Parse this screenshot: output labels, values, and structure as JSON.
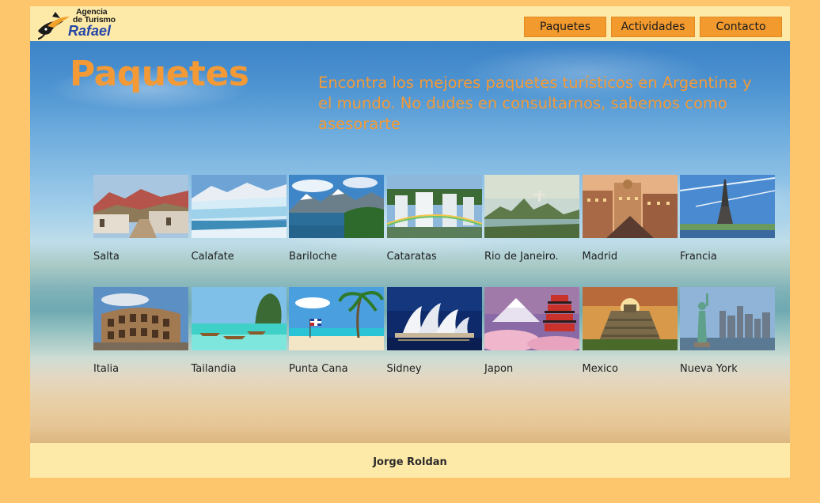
{
  "logo": {
    "line1": "Agencia",
    "line2": "de Turismo",
    "line3": "Rafael"
  },
  "nav": {
    "items": [
      {
        "label": "Paquetes"
      },
      {
        "label": "Actividades"
      },
      {
        "label": "Contacto"
      }
    ]
  },
  "hero": {
    "title": "Paquetes",
    "description": "Encontra los mejores paquetes turísticos en Argentina y el mundo. No dudes en consultarnos, sabemos como asesorarte"
  },
  "packages": {
    "row1": [
      {
        "name": "Salta"
      },
      {
        "name": "Calafate"
      },
      {
        "name": "Bariloche"
      },
      {
        "name": "Cataratas"
      },
      {
        "name": "Rio de Janeiro."
      },
      {
        "name": "Madrid"
      },
      {
        "name": "Francia"
      }
    ],
    "row2": [
      {
        "name": "Italia"
      },
      {
        "name": "Tailandia"
      },
      {
        "name": "Punta Cana"
      },
      {
        "name": "Sidney"
      },
      {
        "name": "Japon"
      },
      {
        "name": "Mexico"
      },
      {
        "name": "Nueva York"
      }
    ]
  },
  "footer": {
    "author": "Jorge Roldan"
  },
  "colors": {
    "page_bg": "#fdc66d",
    "header_bg": "#feeaa8",
    "nav_button": "#f29a2e",
    "accent_text": "#f39a37",
    "logo_blue": "#2446a8"
  }
}
